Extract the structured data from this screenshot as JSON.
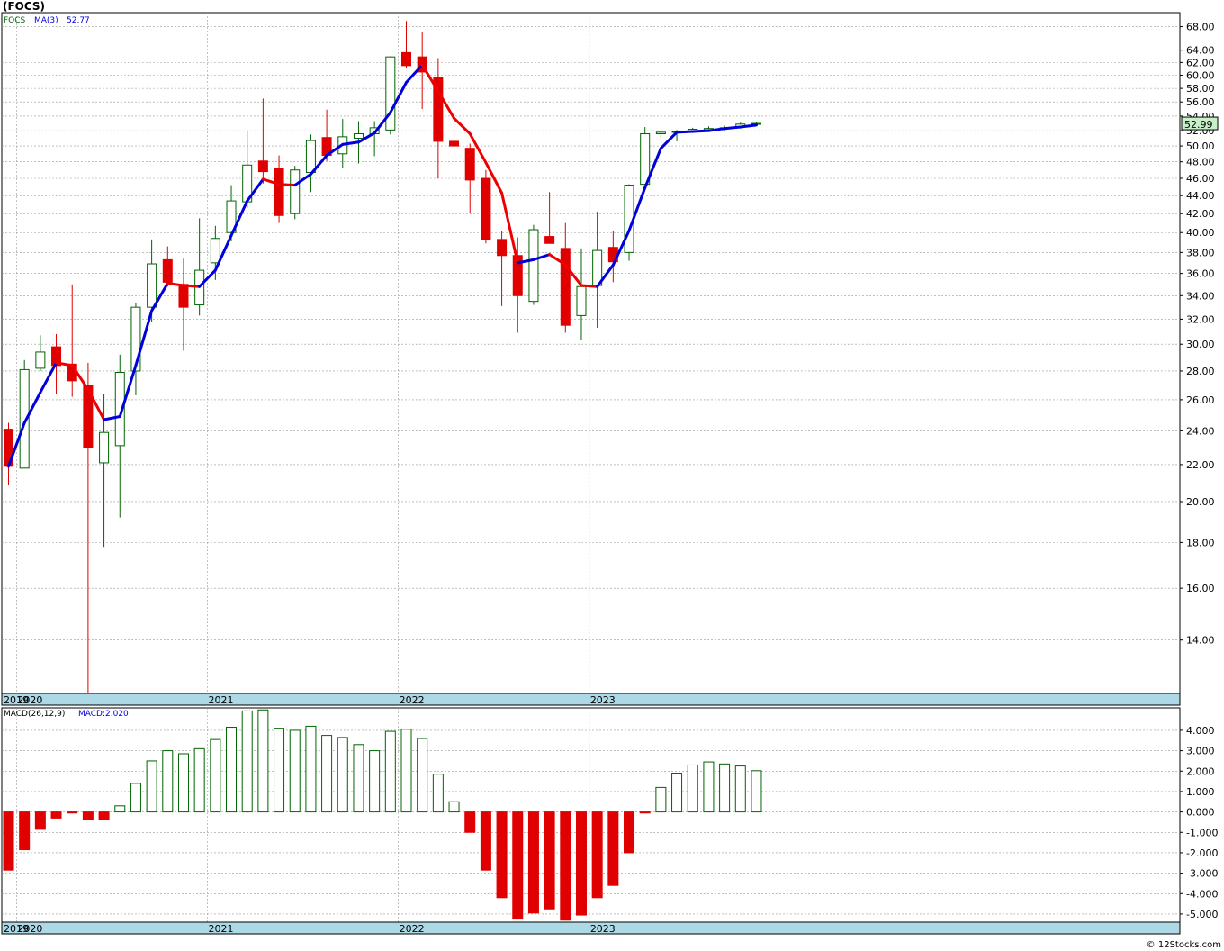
{
  "title": "(FOCS)",
  "credit": "© 12Stocks.com",
  "colors": {
    "up": "#006400",
    "down": "#e00000",
    "ma_up": "#0000dd",
    "ma_down": "#ee0000",
    "axis_band": "#add8e6",
    "grid": "#999999",
    "last_price_bg": "#c8f0c8"
  },
  "x_axis_labels": [
    "2019",
    "2020",
    "2021",
    "2022",
    "2023"
  ],
  "chart_data": [
    {
      "type": "candlestick",
      "legend": {
        "symbol": "FOCS",
        "ma_label": "MA(3)",
        "ma_value": "52.77"
      },
      "last_price": "52.99",
      "scale": "log",
      "ylim": [
        12.2,
        70.5
      ],
      "yticks": [
        "14.00",
        "16.00",
        "18.00",
        "20.00",
        "22.00",
        "24.00",
        "26.00",
        "28.00",
        "30.00",
        "32.00",
        "34.00",
        "36.00",
        "38.00",
        "40.00",
        "42.00",
        "44.00",
        "46.00",
        "48.00",
        "50.00",
        "52.00",
        "54.00",
        "56.00",
        "58.00",
        "60.00",
        "62.00",
        "64.00",
        "68.00"
      ],
      "year_labels": [
        "2019",
        "2020",
        "2021",
        "2022",
        "2023"
      ],
      "candles": [
        {
          "date": "2019-12",
          "open": 24.1,
          "high": 24.5,
          "low": 20.9,
          "close": 21.9
        },
        {
          "date": "2020-01",
          "open": 21.8,
          "high": 28.8,
          "low": 21.8,
          "close": 28.1
        },
        {
          "date": "2020-02",
          "open": 28.2,
          "high": 30.7,
          "low": 28.0,
          "close": 29.4
        },
        {
          "date": "2020-03",
          "open": 29.8,
          "high": 30.8,
          "low": 26.4,
          "close": 28.4
        },
        {
          "date": "2020-04",
          "open": 28.5,
          "high": 35.0,
          "low": 26.2,
          "close": 27.3
        },
        {
          "date": "2020-05",
          "open": 27.0,
          "high": 28.6,
          "low": 12.2,
          "close": 23.0
        },
        {
          "date": "2020-06",
          "open": 22.1,
          "high": 26.4,
          "low": 17.8,
          "close": 23.9
        },
        {
          "date": "2020-07",
          "open": 23.1,
          "high": 29.2,
          "low": 19.2,
          "close": 27.9
        },
        {
          "date": "2020-08",
          "open": 28.0,
          "high": 33.4,
          "low": 26.3,
          "close": 33.0
        },
        {
          "date": "2020-09",
          "open": 33.0,
          "high": 39.3,
          "low": 31.8,
          "close": 36.9
        },
        {
          "date": "2020-10",
          "open": 37.3,
          "high": 38.6,
          "low": 34.8,
          "close": 35.2
        },
        {
          "date": "2020-11",
          "open": 35.0,
          "high": 37.4,
          "low": 29.5,
          "close": 33.0
        },
        {
          "date": "2020-12",
          "open": 33.2,
          "high": 41.5,
          "low": 32.3,
          "close": 36.3
        },
        {
          "date": "2021-01",
          "open": 37.0,
          "high": 40.7,
          "low": 35.4,
          "close": 39.4
        },
        {
          "date": "2021-02",
          "open": 40.0,
          "high": 45.2,
          "low": 39.1,
          "close": 43.4
        },
        {
          "date": "2021-03",
          "open": 43.3,
          "high": 52.0,
          "low": 42.6,
          "close": 47.6
        },
        {
          "date": "2021-04",
          "open": 48.1,
          "high": 56.5,
          "low": 45.4,
          "close": 46.8
        },
        {
          "date": "2021-05",
          "open": 47.2,
          "high": 48.8,
          "low": 41.0,
          "close": 41.8
        },
        {
          "date": "2021-06",
          "open": 42.0,
          "high": 47.5,
          "low": 41.4,
          "close": 47.0
        },
        {
          "date": "2021-07",
          "open": 46.7,
          "high": 51.5,
          "low": 44.4,
          "close": 50.7
        },
        {
          "date": "2021-08",
          "open": 51.1,
          "high": 54.9,
          "low": 48.1,
          "close": 48.8
        },
        {
          "date": "2021-09",
          "open": 49.0,
          "high": 53.6,
          "low": 47.2,
          "close": 51.2
        },
        {
          "date": "2021-10",
          "open": 51.0,
          "high": 53.3,
          "low": 47.8,
          "close": 51.6
        },
        {
          "date": "2021-11",
          "open": 51.6,
          "high": 53.3,
          "low": 48.7,
          "close": 52.4
        },
        {
          "date": "2021-12",
          "open": 52.1,
          "high": 63.0,
          "low": 51.5,
          "close": 62.9
        },
        {
          "date": "2022-01",
          "open": 63.6,
          "high": 69.0,
          "low": 61.2,
          "close": 61.5
        },
        {
          "date": "2022-02",
          "open": 62.9,
          "high": 67.0,
          "low": 55.0,
          "close": 60.5
        },
        {
          "date": "2022-03",
          "open": 59.7,
          "high": 62.7,
          "low": 46.0,
          "close": 50.6
        },
        {
          "date": "2022-04",
          "open": 50.6,
          "high": 54.6,
          "low": 48.5,
          "close": 50.0
        },
        {
          "date": "2022-05",
          "open": 49.7,
          "high": 50.3,
          "low": 42.0,
          "close": 45.8
        },
        {
          "date": "2022-06",
          "open": 46.0,
          "high": 47.0,
          "low": 38.9,
          "close": 39.3
        },
        {
          "date": "2022-07",
          "open": 39.3,
          "high": 40.2,
          "low": 33.1,
          "close": 37.7
        },
        {
          "date": "2022-08",
          "open": 37.7,
          "high": 39.5,
          "low": 30.9,
          "close": 34.0
        },
        {
          "date": "2022-09",
          "open": 33.5,
          "high": 40.8,
          "low": 33.2,
          "close": 40.3
        },
        {
          "date": "2022-10",
          "open": 39.6,
          "high": 44.4,
          "low": 38.9,
          "close": 38.9
        },
        {
          "date": "2022-11",
          "open": 38.4,
          "high": 41.0,
          "low": 30.9,
          "close": 31.5
        },
        {
          "date": "2022-12",
          "open": 32.3,
          "high": 38.4,
          "low": 30.3,
          "close": 34.8
        },
        {
          "date": "2023-01",
          "open": 34.9,
          "high": 42.2,
          "low": 31.3,
          "close": 38.2
        },
        {
          "date": "2023-02",
          "open": 38.5,
          "high": 40.2,
          "low": 35.2,
          "close": 37.1
        },
        {
          "date": "2023-03",
          "open": 38.0,
          "high": 45.3,
          "low": 37.2,
          "close": 45.2
        },
        {
          "date": "2023-04",
          "open": 45.3,
          "high": 52.5,
          "low": 45.2,
          "close": 51.6
        },
        {
          "date": "2023-05",
          "open": 51.6,
          "high": 52.0,
          "low": 51.1,
          "close": 51.8
        },
        {
          "date": "2023-06",
          "open": 51.8,
          "high": 52.1,
          "low": 50.6,
          "close": 51.9
        },
        {
          "date": "2023-07",
          "open": 51.9,
          "high": 52.4,
          "low": 51.7,
          "close": 52.2
        },
        {
          "date": "2023-08",
          "open": 52.1,
          "high": 52.6,
          "low": 51.9,
          "close": 52.3
        },
        {
          "date": "2023-09",
          "open": 52.3,
          "high": 52.7,
          "low": 52.0,
          "close": 52.4
        },
        {
          "date": "2023-10",
          "open": 52.5,
          "high": 53.1,
          "low": 52.3,
          "close": 52.9
        },
        {
          "date": "2023-11",
          "open": 52.9,
          "high": 53.2,
          "low": 52.8,
          "close": 52.99
        }
      ],
      "ma": [
        21.9,
        24.5,
        26.5,
        28.6,
        28.4,
        26.7,
        24.7,
        24.9,
        28.4,
        32.7,
        35.1,
        34.9,
        34.8,
        36.3,
        39.7,
        43.4,
        45.9,
        45.3,
        45.2,
        46.5,
        48.8,
        50.2,
        50.5,
        51.7,
        54.5,
        58.9,
        61.6,
        57.6,
        53.7,
        51.6,
        47.9,
        44.3,
        37.0,
        37.3,
        37.8,
        36.8,
        34.9,
        34.8,
        36.8,
        40.2,
        44.9,
        49.7,
        51.8,
        51.9,
        52.0,
        52.3,
        52.5,
        52.77
      ]
    },
    {
      "type": "bar",
      "legend": {
        "name": "MACD(26,12,9)",
        "value_label": "MACD:2.020"
      },
      "ylim": [
        -5.4,
        5.1
      ],
      "yticks": [
        "-5.000",
        "-4.000",
        "-3.000",
        "-2.000",
        "-1.000",
        "0.000",
        "1.000",
        "2.000",
        "3.000",
        "4.000"
      ],
      "year_labels": [
        "2019",
        "2020",
        "2021",
        "2022",
        "2023"
      ],
      "values": [
        -2.85,
        -1.85,
        -0.85,
        -0.3,
        -0.05,
        -0.35,
        -0.35,
        0.3,
        1.4,
        2.5,
        3.0,
        2.85,
        3.1,
        3.55,
        4.15,
        4.95,
        5.0,
        4.1,
        4.0,
        4.2,
        3.75,
        3.65,
        3.3,
        3.0,
        3.95,
        4.05,
        3.6,
        1.85,
        0.5,
        -1.0,
        -2.85,
        -4.2,
        -5.25,
        -4.95,
        -4.75,
        -5.3,
        -5.05,
        -4.2,
        -3.6,
        -2.0,
        -0.05,
        1.2,
        1.9,
        2.3,
        2.45,
        2.35,
        2.25,
        2.02
      ]
    }
  ]
}
